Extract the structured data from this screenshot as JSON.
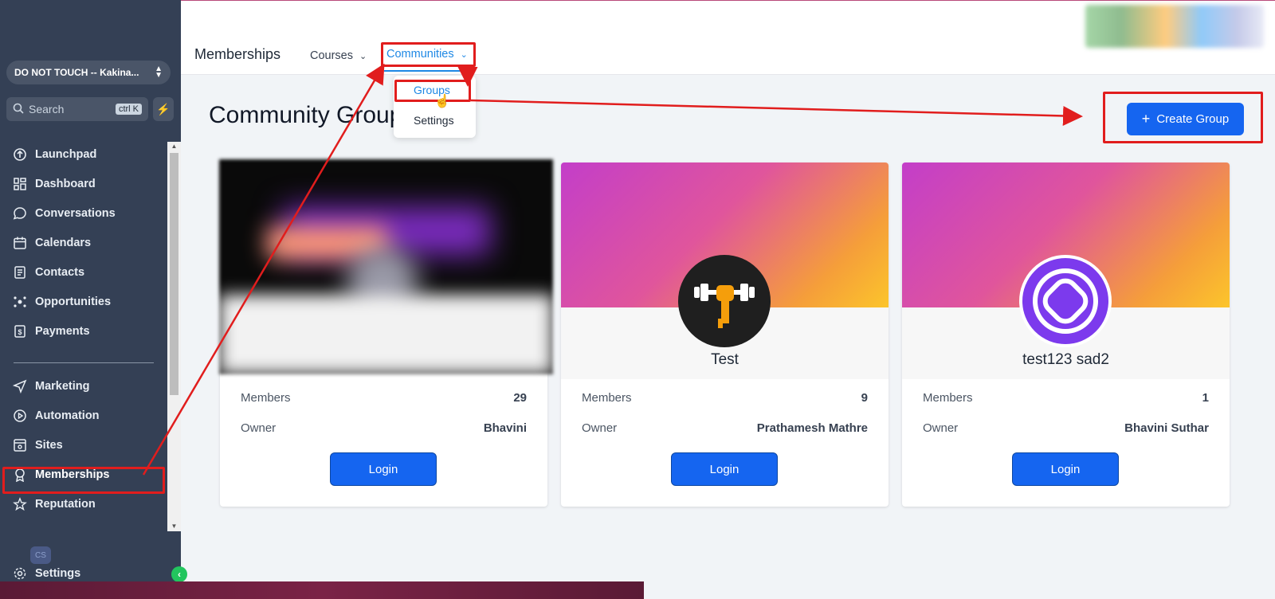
{
  "sidebar": {
    "account": "DO NOT TOUCH -- Kakina...",
    "search_placeholder": "Search",
    "search_shortcut": "ctrl K",
    "items": [
      {
        "label": "Launchpad",
        "icon": "rocket-icon"
      },
      {
        "label": "Dashboard",
        "icon": "grid-icon"
      },
      {
        "label": "Conversations",
        "icon": "chat-icon"
      },
      {
        "label": "Calendars",
        "icon": "calendar-icon"
      },
      {
        "label": "Contacts",
        "icon": "contacts-icon"
      },
      {
        "label": "Opportunities",
        "icon": "opportunities-icon"
      },
      {
        "label": "Payments",
        "icon": "payments-icon"
      },
      {
        "label": "Marketing",
        "icon": "send-icon"
      },
      {
        "label": "Automation",
        "icon": "play-icon"
      },
      {
        "label": "Sites",
        "icon": "sites-icon"
      },
      {
        "label": "Memberships",
        "icon": "badge-icon"
      },
      {
        "label": "Reputation",
        "icon": "star-icon"
      },
      {
        "label": "Settings",
        "icon": "gear-icon"
      }
    ],
    "avatar_initials": "CS"
  },
  "topbar": {
    "title": "Memberships",
    "tabs": [
      "Courses",
      "Communities"
    ]
  },
  "dropdown": {
    "items": [
      "Groups",
      "Settings"
    ]
  },
  "main": {
    "heading": "Community Groups",
    "create_button": "Create Group",
    "members_label": "Members",
    "owner_label": "Owner",
    "login_label": "Login",
    "groups": [
      {
        "name": "",
        "members": "29",
        "owner": "Bhavini"
      },
      {
        "name": "Test",
        "members": "9",
        "owner": "Prathamesh Mathre"
      },
      {
        "name": "test123 sad2",
        "members": "1",
        "owner": "Bhavini Suthar"
      }
    ]
  },
  "colors": {
    "sidebar_bg": "#344055",
    "primary": "#1565f0",
    "accent_link": "#1e88e5",
    "annotation_red": "#e11d1d"
  }
}
